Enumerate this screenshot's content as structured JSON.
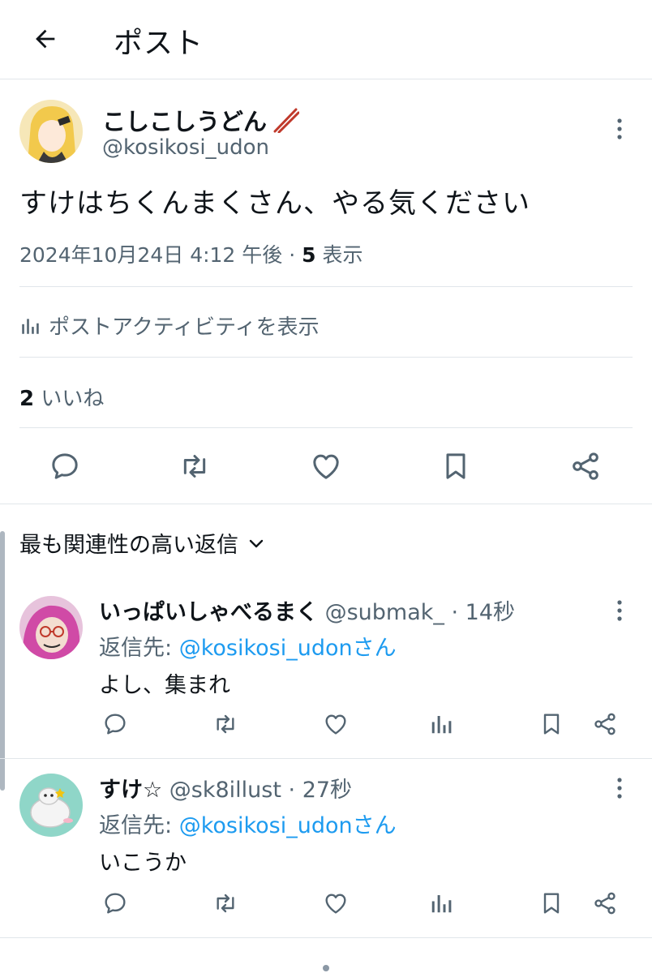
{
  "header": {
    "title": "ポスト"
  },
  "post": {
    "author_name": "こしこしうどん",
    "author_handle": "@kosikosi_udon",
    "text": "すけはちくんまくさん、やる気ください",
    "date": "2024年10月24日 4:12 午後",
    "separator": " · ",
    "views_count": "5",
    "views_label": " 表示",
    "activity_label": "ポストアクティビティを表示",
    "likes_count": "2",
    "likes_label": " いいね"
  },
  "replies_header": {
    "sort_label": "最も関連性の高い返信"
  },
  "replies": [
    {
      "name": "いっぱいしゃべるまく",
      "handle": " @submak_",
      "time": " · 14秒",
      "reply_to_prefix": "返信先: ",
      "reply_to_link": "@kosikosi_udonさん",
      "text": "よし、集まれ"
    },
    {
      "name": "すけ☆",
      "handle": " @sk8illust",
      "time": " · 27秒",
      "reply_to_prefix": "返信先: ",
      "reply_to_link": "@kosikosi_udonさん",
      "text": "いこうか"
    }
  ],
  "colors": {
    "text": "#0f1419",
    "secondary": "#536471",
    "link": "#1d9bf0",
    "divider": "#e1e6ea"
  },
  "icons": [
    "back-arrow-icon",
    "more-vertical-icon",
    "analytics-icon",
    "reply-icon",
    "repost-icon",
    "like-icon",
    "bookmark-icon",
    "share-icon",
    "chevron-down-icon",
    "chopsticks-icon"
  ]
}
